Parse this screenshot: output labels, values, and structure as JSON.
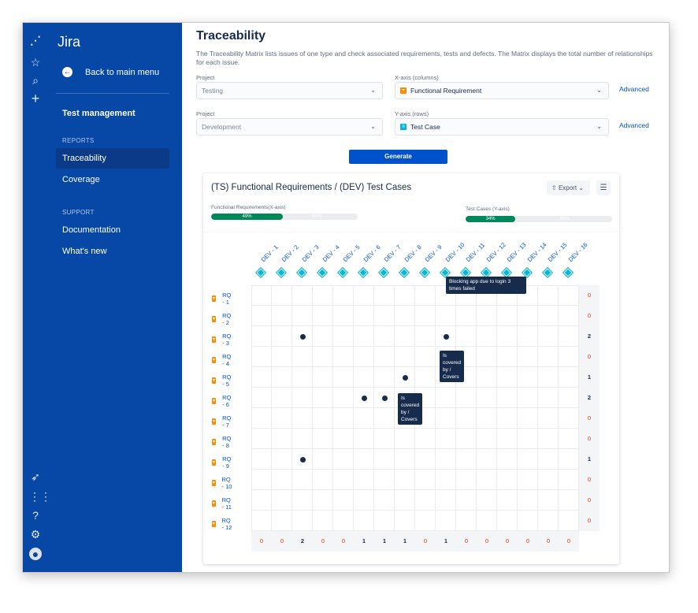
{
  "app": {
    "name": "Jira",
    "back": "Back to main menu",
    "section": "Test management"
  },
  "sidebar": {
    "reports_heading": "REPORTS",
    "reports": [
      {
        "label": "Traceability",
        "active": true
      },
      {
        "label": "Coverage"
      }
    ],
    "support_heading": "SUPPORT",
    "support": [
      {
        "label": "Documentation"
      },
      {
        "label": "What's new"
      }
    ]
  },
  "strip_icons": [
    "jira-logo",
    "star",
    "search",
    "plus",
    "rocket",
    "apps-grid",
    "help",
    "settings",
    "avatar"
  ],
  "page": {
    "title": "Traceability",
    "description": "The Traceability Matrix lists issues of one type and check associated requirements, tests and defects. The Matrix displays the total number of relationships for each issue."
  },
  "form": {
    "project1_label": "Project",
    "project1": "Testing",
    "xaxis_label": "X-axis (columns)",
    "xaxis": "Functional Requirement",
    "advanced1": "Advanced",
    "project2_label": "Project",
    "project2": "Development",
    "yaxis_label": "Y-axis (rows)",
    "yaxis": "Test Case",
    "advanced2": "Advanced",
    "generate": "Generate"
  },
  "matrix": {
    "title": "(TS) Functional Requirements / (DEV) Test Cases",
    "export": "Export",
    "x_progress": {
      "label": "Functional Requirements(X-axis)",
      "covered": 49,
      "covered_label": "49%",
      "rest_label": "51%"
    },
    "y_progress": {
      "label": "Test Cases (Y-axis)",
      "covered": 34,
      "covered_label": "34%",
      "rest_label": "66%"
    },
    "columns": [
      "DEV - 1",
      "DEV - 2",
      "DEV - 3",
      "DEV - 4",
      "DEV - 5",
      "DEV - 6",
      "DEV - 7",
      "DEV - 8",
      "DEV - 9",
      "DEV - 10",
      "DEV - 11",
      "DEV - 12",
      "DEV - 13",
      "DEV - 14",
      "DEV - 15",
      "DEV - 16"
    ],
    "rows": [
      "RQ - 1",
      "RQ - 2",
      "RQ - 3",
      "RQ - 4",
      "RQ - 5",
      "RQ - 6",
      "RQ - 7",
      "RQ - 8",
      "RQ - 9",
      "RQ - 10",
      "RQ - 11",
      "RQ - 12"
    ],
    "links": [
      [
        "RQ - 3",
        "DEV - 3"
      ],
      [
        "RQ - 3",
        "DEV - 10"
      ],
      [
        "RQ - 5",
        "DEV - 8"
      ],
      [
        "RQ - 6",
        "DEV - 6"
      ],
      [
        "RQ - 6",
        "DEV - 7"
      ],
      [
        "RQ - 9",
        "DEV - 3"
      ]
    ],
    "row_totals": [
      "0",
      "0",
      "2",
      "0",
      "1",
      "2",
      "0",
      "0",
      "1",
      "0",
      "0",
      "0"
    ],
    "col_totals": [
      "0",
      "0",
      "2",
      "0",
      "0",
      "1",
      "1",
      "1",
      "0",
      "1",
      "0",
      "0",
      "0",
      "0",
      "0",
      "0"
    ],
    "tooltips": {
      "column": "Blocking app due to login 3 times failed",
      "link1": "Is covered by / Covers",
      "link2": "Is covered by / Covers"
    },
    "colors": {
      "zero": "#DE350B",
      "nonzero": "#172B4D",
      "progress": "#00875A"
    }
  }
}
